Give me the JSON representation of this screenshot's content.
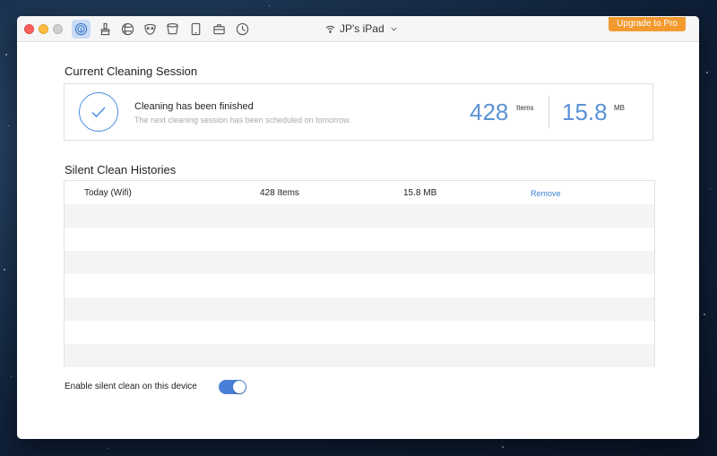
{
  "titlebar": {
    "device_name": "JP's iPad",
    "upgrade_label": "Upgrade to Pro",
    "toolbar_icons": [
      "touch-icon",
      "brush-icon",
      "globe-icon",
      "mask-icon",
      "bucket-icon",
      "tablet-icon",
      "toolbox-icon",
      "history-icon"
    ]
  },
  "session": {
    "title": "Current Cleaning Session",
    "status": "Cleaning has been finished",
    "subtext": "The next cleaning session has been scheduled on tomorrow.",
    "items_count": "428",
    "items_unit": "Items",
    "size_value": "15.8",
    "size_unit": "MB"
  },
  "histories": {
    "title": "Silent Clean Histories",
    "rows": [
      {
        "date": "Today (Wifi)",
        "items": "428 Items",
        "size": "15.8 MB",
        "action": "Remove"
      }
    ]
  },
  "settings": {
    "silent_clean_label": "Enable silent clean on this device",
    "silent_clean_enabled": true
  },
  "colors": {
    "accent": "#4a8ee0",
    "upgrade": "#f29a2e",
    "toggle_on": "#4a7fd8"
  }
}
